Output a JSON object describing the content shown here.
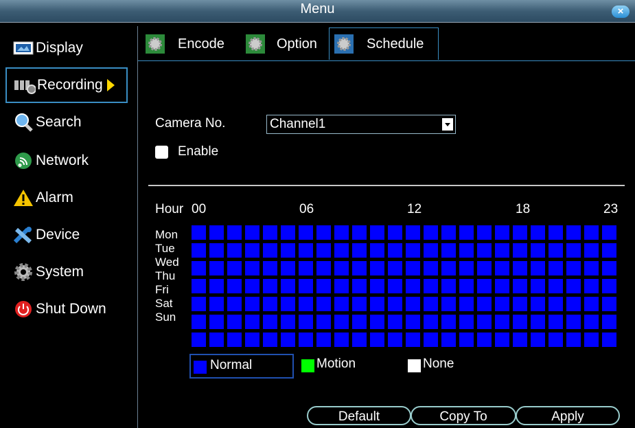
{
  "window": {
    "title": "Menu",
    "close_label": "×"
  },
  "sidebar": {
    "items": [
      {
        "label": "Display",
        "icon": "display-icon"
      },
      {
        "label": "Recording",
        "icon": "recording-icon",
        "active": true
      },
      {
        "label": "Search",
        "icon": "search-icon"
      },
      {
        "label": "Network",
        "icon": "network-icon"
      },
      {
        "label": "Alarm",
        "icon": "alarm-icon"
      },
      {
        "label": "Device",
        "icon": "device-icon"
      },
      {
        "label": "System",
        "icon": "system-icon"
      },
      {
        "label": "Shut Down",
        "icon": "power-icon"
      }
    ]
  },
  "tabs": [
    {
      "label": "Encode"
    },
    {
      "label": "Option"
    },
    {
      "label": "Schedule",
      "active": true
    }
  ],
  "form": {
    "camera_label": "Camera No.",
    "camera_value": "Channel1",
    "enable_label": "Enable",
    "enable_checked": false
  },
  "schedule": {
    "hour_label": "Hour",
    "hour_ticks": [
      "00",
      "06",
      "12",
      "18",
      "23"
    ],
    "days": [
      "Mon",
      "Tue",
      "Wed",
      "Thu",
      "Fri",
      "Sat",
      "Sun"
    ],
    "hours": 24,
    "mode_all": "Normal"
  },
  "legend": [
    {
      "label": "Normal",
      "color": "#0000ff",
      "selected": true
    },
    {
      "label": "Motion",
      "color": "#00ff00"
    },
    {
      "label": "None",
      "color": "#ffffff"
    }
  ],
  "buttons": {
    "default": "Default",
    "copy": "Copy To",
    "apply": "Apply"
  }
}
